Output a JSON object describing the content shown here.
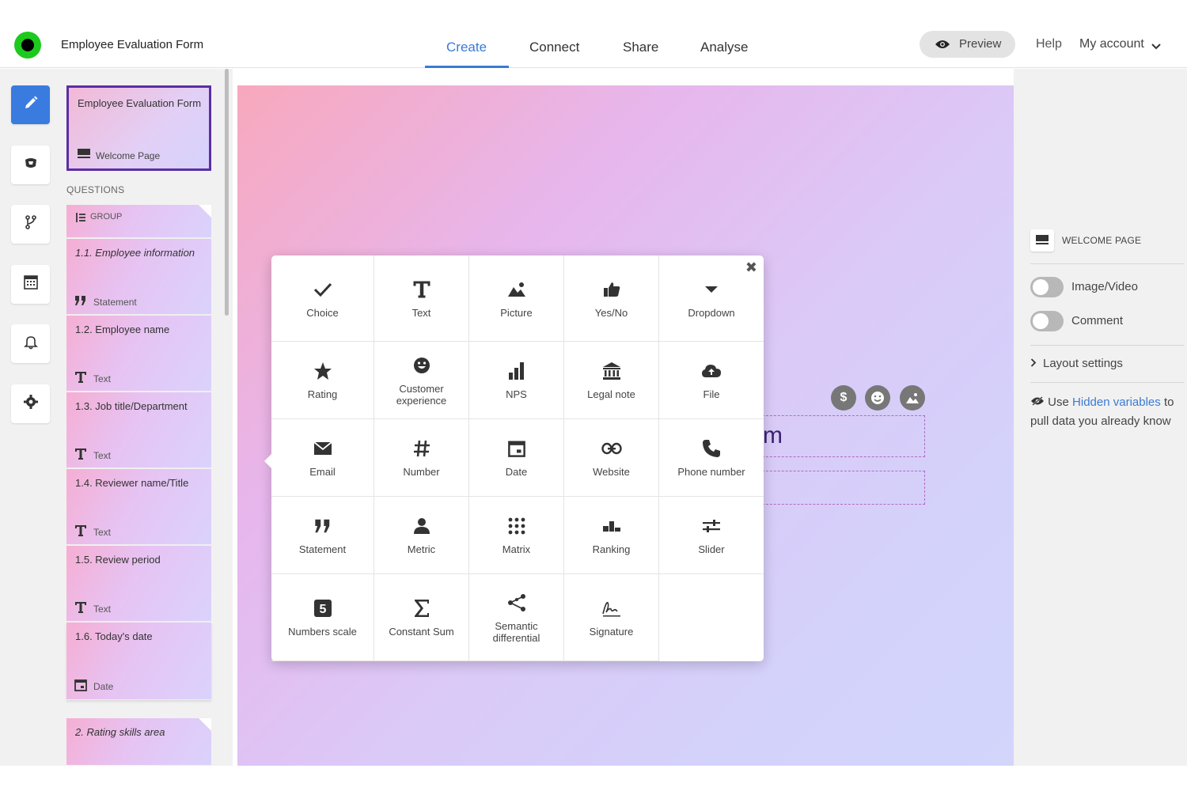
{
  "header": {
    "form_title": "Employee Evaluation Form",
    "tabs": [
      {
        "label": "Create",
        "active": true
      },
      {
        "label": "Connect",
        "active": false
      },
      {
        "label": "Share",
        "active": false
      },
      {
        "label": "Analyse",
        "active": false
      }
    ],
    "preview_label": "Preview",
    "help_label": "Help",
    "account_label": "My account"
  },
  "toolbar": {
    "tools": [
      "pencil-icon",
      "theme-icon",
      "logic-icon",
      "calculator-icon",
      "bell-icon",
      "gear-icon"
    ]
  },
  "sidebar": {
    "welcome_title": "Employee Evaluation Form",
    "welcome_type": "Welcome Page",
    "questions_header": "QUESTIONS",
    "group_label": "GROUP",
    "questions": [
      {
        "title": "1.1. Employee information",
        "type": "Statement"
      },
      {
        "title": "1.2. Employee name",
        "type": "Text"
      },
      {
        "title": "1.3. Job title/Department",
        "type": "Text"
      },
      {
        "title": "1.4. Reviewer name/Title",
        "type": "Text"
      },
      {
        "title": "1.5. Review period",
        "type": "Text"
      },
      {
        "title": "1.6. Today's date",
        "type": "Date"
      }
    ],
    "next_group_title": "2. Rating skills area"
  },
  "picker": {
    "items": [
      {
        "label": "Choice",
        "icon": "checkmark-icon"
      },
      {
        "label": "Text",
        "icon": "text-icon"
      },
      {
        "label": "Picture",
        "icon": "picture-icon"
      },
      {
        "label": "Yes/No",
        "icon": "thumbs-up-icon"
      },
      {
        "label": "Dropdown",
        "icon": "dropdown-icon"
      },
      {
        "label": "Rating",
        "icon": "star-icon"
      },
      {
        "label": "Customer experience",
        "icon": "smiley-icon"
      },
      {
        "label": "NPS",
        "icon": "bar-chart-icon"
      },
      {
        "label": "Legal note",
        "icon": "bank-icon"
      },
      {
        "label": "File",
        "icon": "cloud-upload-icon"
      },
      {
        "label": "Email",
        "icon": "envelope-icon"
      },
      {
        "label": "Number",
        "icon": "hash-icon"
      },
      {
        "label": "Date",
        "icon": "calendar-icon"
      },
      {
        "label": "Website",
        "icon": "link-icon"
      },
      {
        "label": "Phone number",
        "icon": "phone-icon"
      },
      {
        "label": "Statement",
        "icon": "quote-icon"
      },
      {
        "label": "Metric",
        "icon": "person-icon"
      },
      {
        "label": "Matrix",
        "icon": "dots-grid-icon"
      },
      {
        "label": "Ranking",
        "icon": "podium-icon"
      },
      {
        "label": "Slider",
        "icon": "slider-icon"
      },
      {
        "label": "Numbers scale",
        "icon": "number-five-icon"
      },
      {
        "label": "Constant Sum",
        "icon": "sigma-icon"
      },
      {
        "label": "Semantic differential",
        "icon": "share-nodes-icon"
      },
      {
        "label": "Signature",
        "icon": "signature-icon"
      }
    ]
  },
  "canvas": {
    "partial_title": "m"
  },
  "right_panel": {
    "title": "WELCOME PAGE",
    "toggles": [
      {
        "label": "Image/Video",
        "on": false
      },
      {
        "label": "Comment",
        "on": false
      }
    ],
    "layout_settings": "Layout settings",
    "hidden_prefix": "Use",
    "hidden_link": "Hidden variables",
    "hidden_suffix": "to pull data you already know"
  }
}
